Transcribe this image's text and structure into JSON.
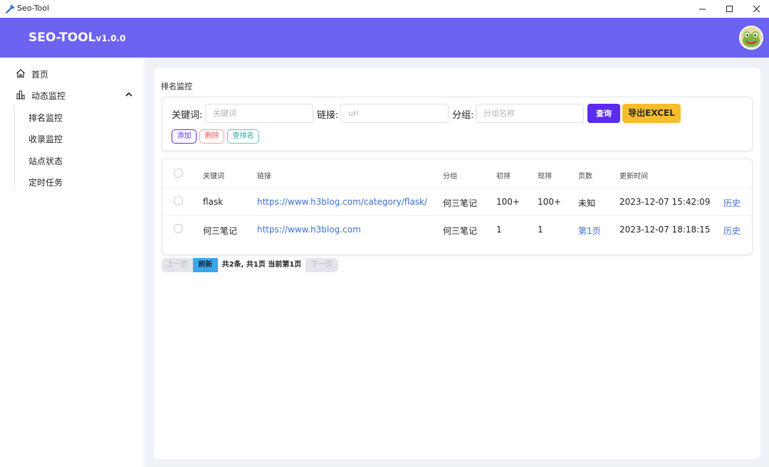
{
  "window": {
    "title": "Seo-Tool",
    "icon": "wrench-icon"
  },
  "header": {
    "brand": "SEO-TOOL",
    "version": "v1.0.0",
    "color": "#6c63f0"
  },
  "sidebar": {
    "home": "首页",
    "dynamic_monitor": "动态监控",
    "sub_items": [
      "排名监控",
      "收录监控",
      "站点状态",
      "定时任务"
    ]
  },
  "main": {
    "section_title": "排名监控",
    "search": {
      "keyword_label": "关键词:",
      "keyword_placeholder": "关键词",
      "link_label": "链接:",
      "link_placeholder": "url",
      "group_label": "分组:",
      "group_placeholder": "分组名称",
      "query_button": "查询",
      "export_button": "导出EXCEL",
      "add_button": "添加",
      "delete_button": "删除",
      "check_rank_button": "查排名"
    },
    "table": {
      "headers": [
        "关键词",
        "链接",
        "分组",
        "初排",
        "现排",
        "页数",
        "更新时间"
      ],
      "rows": [
        {
          "keyword": "flask",
          "link": "https://www.h3blog.com/category/flask/",
          "group": "何三笔记",
          "initial_rank": "100+",
          "current_rank": "100+",
          "pages": "未知",
          "updated": "2023-12-07 15:42:09",
          "action": "历史"
        },
        {
          "keyword": "何三笔记",
          "link": "https://www.h3blog.com",
          "group": "何三笔记",
          "initial_rank": "1",
          "current_rank": "1",
          "pages": "第1页",
          "updated": "2023-12-07 18:18:15",
          "action": "历史"
        }
      ]
    },
    "pager": {
      "prev": "上一页",
      "refresh": "刷新",
      "summary": "共2条, 共1页 当前第1页",
      "next": "下一页"
    }
  }
}
